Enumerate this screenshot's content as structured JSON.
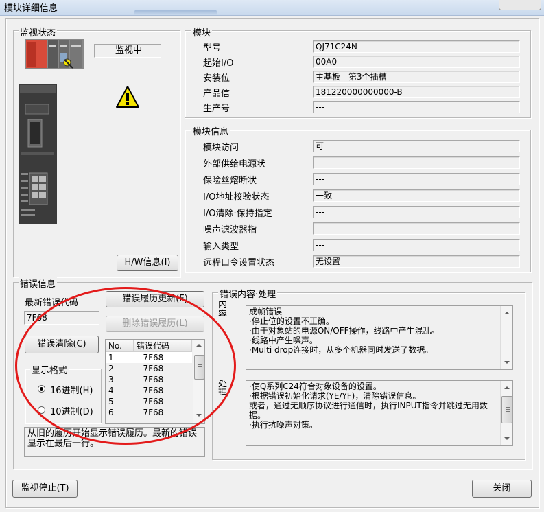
{
  "window": {
    "title": "模块详细信息"
  },
  "monitor": {
    "group_label": "监视状态",
    "status": "监视中"
  },
  "hw_button": "H/W信息(I)",
  "module": {
    "group_label": "模块",
    "rows": [
      {
        "label": "型号",
        "value": "QJ71C24N"
      },
      {
        "label": "起始I/O",
        "value": "00A0"
      },
      {
        "label": "安装位",
        "value": "主基板　第3个插槽"
      },
      {
        "label": "产品信",
        "value": "181220000000000-B"
      },
      {
        "label": "生产号",
        "value": "---"
      }
    ]
  },
  "module_info": {
    "group_label": "模块信息",
    "rows": [
      {
        "label": "模块访问",
        "value": "可"
      },
      {
        "label": "外部供给电源状",
        "value": "---"
      },
      {
        "label": "保险丝熔断状",
        "value": "---"
      },
      {
        "label": "I/O地址校验状态",
        "value": "一致"
      },
      {
        "label": "I/O清除·保持指定",
        "value": "---"
      },
      {
        "label": "噪声滤波器指",
        "value": "---"
      },
      {
        "label": "输入类型",
        "value": "---"
      },
      {
        "label": "远程口令设置状态",
        "value": "无设置"
      }
    ]
  },
  "error_info": {
    "group_label": "错误信息",
    "latest_label": "最新错误代码",
    "latest_value": "7F68",
    "update_button": "错误履历更新(F)",
    "delete_button": "删除错误履历(L)",
    "clear_button": "错误清除(C)",
    "format_group_label": "显示格式",
    "radio_hex": "16进制(H)",
    "radio_dec": "10进制(D)",
    "table": {
      "col_no": "No.",
      "col_code": "错误代码",
      "rows": [
        {
          "no": "1",
          "code": "7F68"
        },
        {
          "no": "2",
          "code": "7F68"
        },
        {
          "no": "3",
          "code": "7F68"
        },
        {
          "no": "4",
          "code": "7F68"
        },
        {
          "no": "5",
          "code": "7F68"
        },
        {
          "no": "6",
          "code": "7F68"
        }
      ]
    },
    "note": "从旧的履历开始显示错误履历。最新的错误显示在最后一行。"
  },
  "error_detail": {
    "group_label": "错误内容·处理",
    "content_label": "内容",
    "content_text": "成帧错误\n·停止位的设置不正确。\n·由于对象站的电源ON/OFF操作，线路中产生混乱。\n·线路中产生噪声。\n·Multi drop连接时，从多个机器同时发送了数据。",
    "action_label": "处理",
    "action_text": "·使Q系列C24符合对象设备的设置。\n·根据错误初始化请求(YE/YF)，清除错误信息。\n或者，通过无顺序协议进行通信时，执行INPUT指令并跳过无用数据。\n·执行抗噪声对策。"
  },
  "footer": {
    "stop_button": "监视停止(T)",
    "close_button": "关闭"
  },
  "colors": {
    "highlight": "#e31b1b",
    "warning": "#f5e400"
  }
}
